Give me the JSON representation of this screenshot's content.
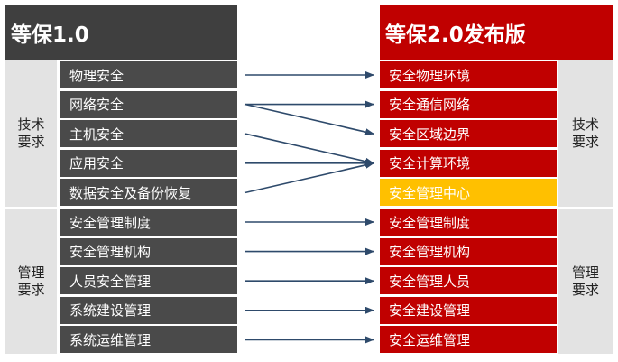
{
  "left": {
    "header": "等保1.0",
    "categories": [
      "技术要求",
      "管理要求"
    ],
    "items": [
      "物理安全",
      "网络安全",
      "主机安全",
      "应用安全",
      "数据安全及备份恢复",
      "安全管理制度",
      "安全管理机构",
      "人员安全管理",
      "系统建设管理",
      "系统运维管理"
    ]
  },
  "right": {
    "header": "等保2.0发布版",
    "categories": [
      "技术要求",
      "管理要求"
    ],
    "items": [
      "安全物理环境",
      "安全通信网络",
      "安全区域边界",
      "安全计算环境",
      "安全管理中心",
      "安全管理制度",
      "安全管理机构",
      "安全管理人员",
      "安全建设管理",
      "安全运维管理"
    ],
    "highlight_index": 4
  },
  "mappings": [
    [
      0,
      0
    ],
    [
      1,
      1
    ],
    [
      1,
      2
    ],
    [
      2,
      3
    ],
    [
      3,
      3
    ],
    [
      4,
      3
    ],
    [
      5,
      5
    ],
    [
      6,
      6
    ],
    [
      7,
      7
    ],
    [
      8,
      8
    ],
    [
      9,
      9
    ]
  ],
  "colors": {
    "left_header": "#3f3f3f",
    "right_header": "#c00000",
    "left_item": "#4a4a4a",
    "right_item": "#c00000",
    "highlight_item": "#ffc000",
    "category_bg": "#e3e3e3",
    "arrow": "#2e4a6b"
  }
}
